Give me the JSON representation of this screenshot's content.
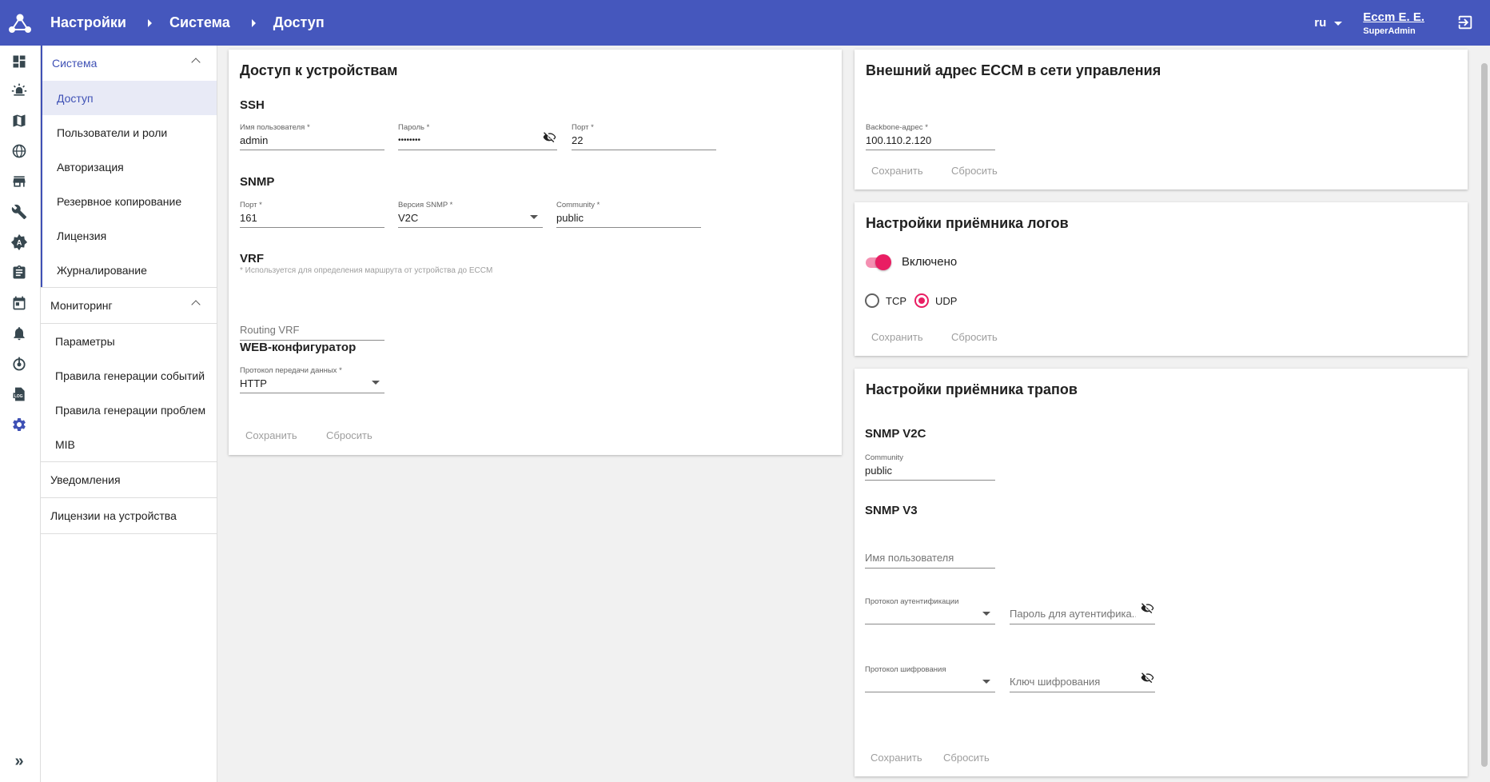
{
  "header": {
    "breadcrumbs": [
      "Настройки",
      "Система",
      "Доступ"
    ],
    "lang": "ru",
    "user_name": "Eccm E. E.",
    "user_role": "SuperAdmin"
  },
  "rail_icons": [
    "dashboard-icon",
    "alarm-icon",
    "map-icon",
    "globe-icon",
    "store-icon",
    "wrench-icon",
    "auto-icon",
    "clipboard-icon",
    "calendar-icon",
    "bell-icon",
    "power-icon",
    "log-icon",
    "gear-icon"
  ],
  "menu": {
    "system": {
      "label": "Система",
      "items": [
        "Доступ",
        "Пользователи и роли",
        "Авторизация",
        "Резервное копирование",
        "Лицензия",
        "Журналирование"
      ]
    },
    "monitoring": {
      "label": "Мониторинг",
      "items": [
        "Параметры",
        "Правила генерации событий",
        "Правила генерации проблем",
        "MIB"
      ]
    },
    "notifications": "Уведомления",
    "device_licenses": "Лицензии на устройства"
  },
  "access": {
    "title": "Доступ к устройствам",
    "ssh": {
      "title": "SSH",
      "username_label": "Имя пользователя *",
      "username": "admin",
      "password_label": "Пароль *",
      "password": "••••••••",
      "port_label": "Порт *",
      "port": "22"
    },
    "snmp": {
      "title": "SNMP",
      "port_label": "Порт *",
      "port": "161",
      "version_label": "Версия SNMP *",
      "version": "V2C",
      "community_label": "Community *",
      "community": "public"
    },
    "vrf": {
      "title": "VRF",
      "hint": "* Используется для определения маршрута от устройства до ECCM",
      "placeholder": "Routing VRF"
    },
    "web": {
      "title": "WEB-конфигуратор",
      "protocol_label": "Протокол передачи данных *",
      "protocol": "HTTP"
    },
    "save": "Сохранить",
    "reset": "Сбросить"
  },
  "external": {
    "title": "Внешний адрес ECCM в сети управления",
    "backbone_label": "Backbone-адрес *",
    "backbone": "100.110.2.120",
    "save": "Сохранить",
    "reset": "Сбросить"
  },
  "logs": {
    "title": "Настройки приёмника логов",
    "enabled_label": "Включено",
    "enabled": true,
    "tcp": "TCP",
    "udp": "UDP",
    "selected": "UDP",
    "save": "Сохранить",
    "reset": "Сбросить"
  },
  "traps": {
    "title": "Настройки приёмника трапов",
    "v2c_title": "SNMP V2C",
    "community_label": "Community",
    "community": "public",
    "v3_title": "SNMP V3",
    "username_placeholder": "Имя пользователя",
    "auth_protocol_label": "Протокол аутентификации",
    "auth_password_placeholder": "Пароль для аутентифика...",
    "enc_protocol_label": "Протокол шифрования",
    "enc_key_placeholder": "Ключ шифрования",
    "save": "Сохранить",
    "reset": "Сбросить"
  },
  "colors": {
    "primary": "#4557bd",
    "accent": "#e91e63",
    "selected_bg": "#e8eaf6"
  }
}
